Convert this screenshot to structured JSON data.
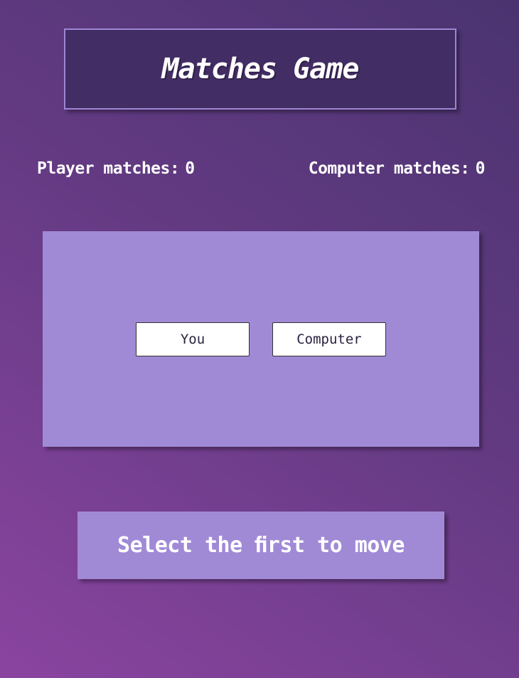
{
  "title": "Matches Game",
  "scores": {
    "player_label": "Player matches:",
    "player_value": "0",
    "computer_label": "Computer matches:",
    "computer_value": "0"
  },
  "board": {
    "you_button": "You",
    "computer_button": "Computer"
  },
  "status": "Select the ﬁrst to move",
  "colors": {
    "background_top": "#4a3370",
    "background_bottom": "#8a44a0",
    "title_box": "#422d64",
    "title_border": "#9e86d4",
    "panel": "#a08ad6",
    "button_bg": "#ffffff",
    "button_text": "#2b2340"
  }
}
